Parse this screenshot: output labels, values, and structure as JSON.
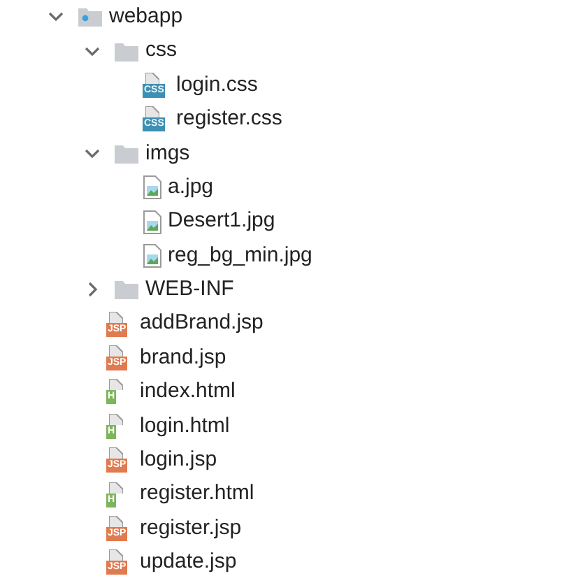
{
  "tree": [
    {
      "kind": "web-folder",
      "label": "webapp",
      "expanded": true,
      "children": [
        {
          "kind": "folder",
          "label": "css",
          "expanded": true,
          "children": [
            {
              "kind": "css",
              "label": "login.css",
              "badge": "CSS"
            },
            {
              "kind": "css",
              "label": "register.css",
              "badge": "CSS"
            }
          ]
        },
        {
          "kind": "folder",
          "label": "imgs",
          "expanded": true,
          "children": [
            {
              "kind": "image",
              "label": "a.jpg"
            },
            {
              "kind": "image",
              "label": "Desert1.jpg"
            },
            {
              "kind": "image",
              "label": "reg_bg_min.jpg"
            }
          ]
        },
        {
          "kind": "folder",
          "label": "WEB-INF",
          "expanded": false
        },
        {
          "kind": "jsp",
          "label": "addBrand.jsp",
          "badge": "JSP"
        },
        {
          "kind": "jsp",
          "label": "brand.jsp",
          "badge": "JSP"
        },
        {
          "kind": "html",
          "label": "index.html",
          "badge": "H"
        },
        {
          "kind": "html",
          "label": "login.html",
          "badge": "H"
        },
        {
          "kind": "jsp",
          "label": "login.jsp",
          "badge": "JSP"
        },
        {
          "kind": "html",
          "label": "register.html",
          "badge": "H"
        },
        {
          "kind": "jsp",
          "label": "register.jsp",
          "badge": "JSP"
        },
        {
          "kind": "jsp",
          "label": "update.jsp",
          "badge": "JSP"
        }
      ]
    }
  ]
}
